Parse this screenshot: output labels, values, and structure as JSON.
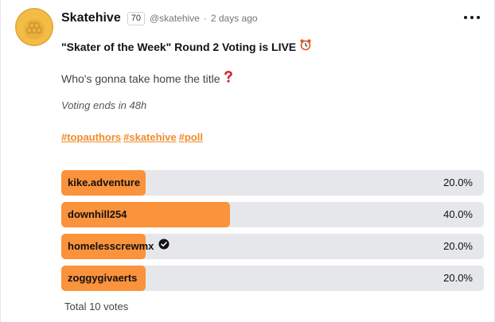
{
  "post": {
    "author": "Skatehive",
    "reputation": "70",
    "handle": "@skatehive",
    "separator": "·",
    "time": "2 days ago",
    "title": "\"Skater of the Week\" Round 2 Voting is LIVE",
    "question": "Who's gonna take home the title",
    "note": "Voting ends in 48h",
    "tags": [
      "#topauthors",
      "#skatehive",
      "#poll"
    ]
  },
  "poll": {
    "options": [
      {
        "label": "kike.adventure",
        "percent_text": "20.0%",
        "percent": 20.0,
        "verified": false
      },
      {
        "label": "downhill254",
        "percent_text": "40.0%",
        "percent": 40.0,
        "verified": false
      },
      {
        "label": "homelesscrewmx",
        "percent_text": "20.0%",
        "percent": 20.0,
        "verified": true
      },
      {
        "label": "zoggygivaerts",
        "percent_text": "20.0%",
        "percent": 20.0,
        "verified": false
      }
    ],
    "total": "Total 10 votes"
  },
  "colors": {
    "accent": "#fb923c",
    "tag": "#f08b2c",
    "bar_track": "#e6e7eb"
  },
  "icons": {
    "more": "more-horizontal-icon",
    "alarm": "alarm-clock-icon",
    "question": "red-question-mark-icon",
    "verified": "verified-check-icon"
  }
}
